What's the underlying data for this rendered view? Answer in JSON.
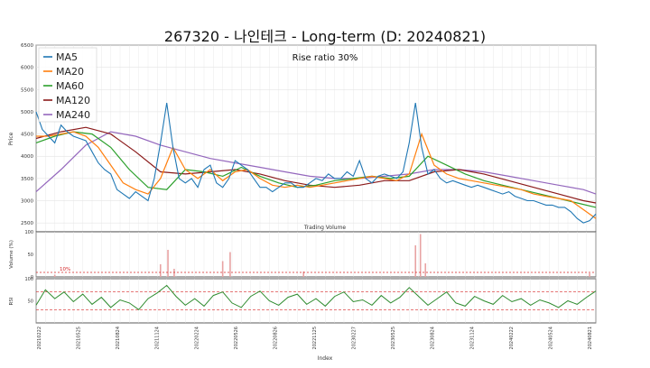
{
  "title": "267320 - 나인테크 - Long-term (D: 20240821)",
  "annotation": "Rise ratio 30%",
  "volume_title": "Trading Volume",
  "volume_threshold_label": "10%",
  "y_labels": {
    "price": "Price",
    "volume": "Volume (%)",
    "rsi": "RSI"
  },
  "x_label": "Index",
  "colors": {
    "price": "#1a2a6c",
    "MA5": "#1f77b4",
    "MA20": "#ff7f0e",
    "MA60": "#2ca02c",
    "MA120": "#8b1a1a",
    "MA240": "#9467bd",
    "volume_bar": "#e8a3a3",
    "rsi": "#2e8b2e",
    "threshold": "#d62728"
  },
  "chart_data": [
    {
      "type": "line",
      "panel": "price",
      "ylim": [
        2300,
        6500
      ],
      "yticks": [
        2500,
        3000,
        3500,
        4000,
        4500,
        5000,
        5500,
        6000,
        6500
      ],
      "grid": true,
      "legend_position": "top-left",
      "x_ticks": [
        "20210222",
        "20210525",
        "20210824",
        "20211124",
        "20220224",
        "20220526",
        "20220826",
        "20221125",
        "20230227",
        "20230525",
        "20230824",
        "20231124",
        "20240222",
        "20240524",
        "20240821"
      ],
      "series": [
        {
          "name": "MA5",
          "x": [
            0,
            10,
            20,
            30,
            40,
            50,
            60,
            70,
            80,
            90,
            100,
            110,
            120,
            130,
            140,
            150,
            160,
            170,
            180,
            190,
            200,
            210,
            220,
            230,
            240,
            250,
            260,
            270,
            280,
            290,
            300,
            310,
            320,
            330,
            340,
            350,
            360,
            370,
            380,
            390,
            400,
            410,
            420,
            430,
            440,
            450,
            460,
            470,
            480,
            490,
            500,
            510,
            520,
            530,
            540,
            550,
            560,
            570,
            580,
            590,
            600,
            610,
            620,
            630,
            640,
            650,
            660,
            670,
            680,
            690,
            700,
            710,
            720,
            730,
            740,
            750,
            760,
            770,
            780,
            790,
            800,
            810,
            820,
            830,
            840,
            850,
            860,
            870,
            880,
            890,
            900
          ],
          "y": [
            5000,
            4600,
            4450,
            4300,
            4700,
            4550,
            4450,
            4400,
            4350,
            4100,
            3850,
            3700,
            3600,
            3250,
            3150,
            3050,
            3200,
            3100,
            3000,
            3500,
            4300,
            5200,
            4200,
            3500,
            3400,
            3500,
            3300,
            3700,
            3800,
            3400,
            3300,
            3500,
            3900,
            3800,
            3700,
            3500,
            3300,
            3300,
            3200,
            3300,
            3400,
            3400,
            3300,
            3300,
            3400,
            3500,
            3450,
            3600,
            3500,
            3500,
            3650,
            3550,
            3900,
            3500,
            3400,
            3550,
            3600,
            3550,
            3500,
            3650,
            4300,
            5200,
            4200,
            3600,
            3700,
            3500,
            3400,
            3450,
            3400,
            3350,
            3300,
            3350,
            3300,
            3250,
            3200,
            3150,
            3200,
            3100,
            3050,
            3000,
            3000,
            2950,
            2900,
            2900,
            2850,
            2850,
            2750,
            2600,
            2500,
            2550,
            2700
          ]
        },
        {
          "name": "MA20",
          "x": [
            0,
            20,
            40,
            60,
            80,
            100,
            120,
            140,
            160,
            180,
            200,
            220,
            240,
            260,
            280,
            300,
            320,
            340,
            360,
            380,
            400,
            420,
            440,
            460,
            480,
            500,
            520,
            540,
            560,
            580,
            600,
            620,
            640,
            660,
            680,
            700,
            720,
            740,
            760,
            780,
            800,
            820,
            840,
            860,
            880,
            900
          ],
          "y": [
            4450,
            4450,
            4500,
            4550,
            4450,
            4200,
            3800,
            3400,
            3250,
            3150,
            3500,
            4200,
            3700,
            3500,
            3700,
            3450,
            3650,
            3700,
            3500,
            3350,
            3300,
            3350,
            3300,
            3350,
            3400,
            3450,
            3500,
            3550,
            3500,
            3450,
            3600,
            4500,
            3800,
            3600,
            3500,
            3450,
            3400,
            3350,
            3300,
            3250,
            3150,
            3100,
            3050,
            3000,
            2800,
            2600
          ]
        },
        {
          "name": "MA60",
          "x": [
            0,
            30,
            60,
            90,
            120,
            150,
            180,
            210,
            240,
            270,
            300,
            330,
            360,
            390,
            420,
            450,
            480,
            510,
            540,
            570,
            600,
            630,
            660,
            690,
            720,
            750,
            780,
            810,
            840,
            870,
            900
          ],
          "y": [
            4300,
            4450,
            4550,
            4500,
            4200,
            3700,
            3300,
            3250,
            3700,
            3650,
            3550,
            3750,
            3550,
            3400,
            3300,
            3350,
            3450,
            3500,
            3550,
            3500,
            3550,
            4000,
            3800,
            3600,
            3450,
            3350,
            3250,
            3150,
            3050,
            2950,
            2850
          ]
        },
        {
          "name": "MA120",
          "x": [
            0,
            40,
            80,
            120,
            160,
            200,
            240,
            280,
            320,
            360,
            400,
            440,
            480,
            520,
            560,
            600,
            640,
            680,
            720,
            760,
            800,
            840,
            880,
            900
          ],
          "y": [
            4400,
            4550,
            4650,
            4500,
            4100,
            3650,
            3600,
            3650,
            3700,
            3600,
            3450,
            3350,
            3300,
            3350,
            3450,
            3450,
            3650,
            3700,
            3600,
            3450,
            3300,
            3150,
            3000,
            2950
          ]
        },
        {
          "name": "MA240",
          "x": [
            0,
            40,
            80,
            120,
            160,
            200,
            240,
            280,
            320,
            360,
            400,
            440,
            480,
            520,
            560,
            600,
            640,
            680,
            720,
            760,
            800,
            840,
            880,
            900
          ],
          "y": [
            3200,
            3700,
            4250,
            4550,
            4450,
            4250,
            4100,
            3950,
            3850,
            3750,
            3650,
            3550,
            3500,
            3500,
            3550,
            3600,
            3700,
            3700,
            3650,
            3550,
            3450,
            3350,
            3250,
            3150
          ]
        }
      ]
    },
    {
      "type": "bar",
      "panel": "volume",
      "ylim": [
        0,
        100
      ],
      "yticks": [
        0,
        50,
        100
      ],
      "threshold": 10,
      "spikes": [
        {
          "x": 30,
          "value": 5
        },
        {
          "x": 200,
          "value": 28
        },
        {
          "x": 212,
          "value": 60
        },
        {
          "x": 222,
          "value": 18
        },
        {
          "x": 300,
          "value": 35
        },
        {
          "x": 312,
          "value": 55
        },
        {
          "x": 430,
          "value": 12
        },
        {
          "x": 610,
          "value": 70
        },
        {
          "x": 618,
          "value": 95
        },
        {
          "x": 626,
          "value": 30
        },
        {
          "x": 890,
          "value": 8
        }
      ]
    },
    {
      "type": "line",
      "panel": "rsi",
      "ylim": [
        0,
        100
      ],
      "yticks": [
        50,
        100
      ],
      "thresholds": [
        70,
        30
      ],
      "x": [
        0,
        15,
        30,
        45,
        60,
        75,
        90,
        105,
        120,
        135,
        150,
        165,
        180,
        195,
        210,
        225,
        240,
        255,
        270,
        285,
        300,
        315,
        330,
        345,
        360,
        375,
        390,
        405,
        420,
        435,
        450,
        465,
        480,
        495,
        510,
        525,
        540,
        555,
        570,
        585,
        600,
        615,
        630,
        645,
        660,
        675,
        690,
        705,
        720,
        735,
        750,
        765,
        780,
        795,
        810,
        825,
        840,
        855,
        870,
        885,
        900
      ],
      "y": [
        40,
        75,
        55,
        70,
        48,
        65,
        42,
        58,
        35,
        52,
        45,
        30,
        55,
        68,
        85,
        60,
        40,
        55,
        38,
        62,
        70,
        45,
        35,
        60,
        72,
        50,
        40,
        58,
        65,
        42,
        55,
        38,
        60,
        70,
        48,
        52,
        40,
        62,
        45,
        58,
        80,
        60,
        40,
        55,
        70,
        45,
        38,
        60,
        50,
        42,
        62,
        48,
        55,
        40,
        52,
        45,
        35,
        50,
        42,
        58,
        72
      ]
    }
  ]
}
